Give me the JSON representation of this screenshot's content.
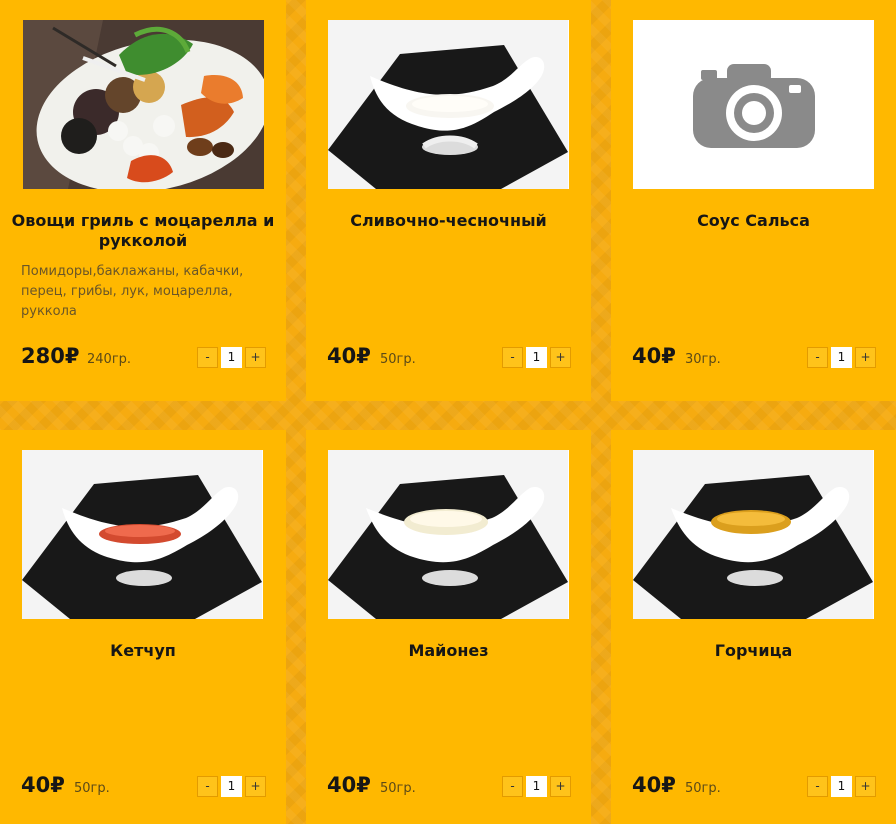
{
  "cards": [
    {
      "name": "Овощи гриль с моцарелла и рукколой",
      "description": "Помидоры,баклажаны, кабачки, перец, грибы, лук, моцарелла, руккола",
      "price": "280₽",
      "weight": "240гр.",
      "quantity": "1"
    },
    {
      "name": "Сливочно-чесночный",
      "description": "",
      "price": "40₽",
      "weight": "50гр.",
      "quantity": "1"
    },
    {
      "name": "Соус Сальса",
      "description": "",
      "price": "40₽",
      "weight": "30гр.",
      "quantity": "1"
    },
    {
      "name": "Кетчуп",
      "description": "",
      "price": "40₽",
      "weight": "50гр.",
      "quantity": "1"
    },
    {
      "name": "Майонез",
      "description": "",
      "price": "40₽",
      "weight": "50гр.",
      "quantity": "1"
    },
    {
      "name": "Горчица",
      "description": "",
      "price": "40₽",
      "weight": "50гр.",
      "quantity": "1"
    }
  ],
  "controls": {
    "minus": "-",
    "plus": "+"
  },
  "colors": {
    "background": "#f6ab10",
    "card": "#ffb800",
    "text": "#161616"
  },
  "icons": {
    "placeholder": "camera-icon"
  }
}
